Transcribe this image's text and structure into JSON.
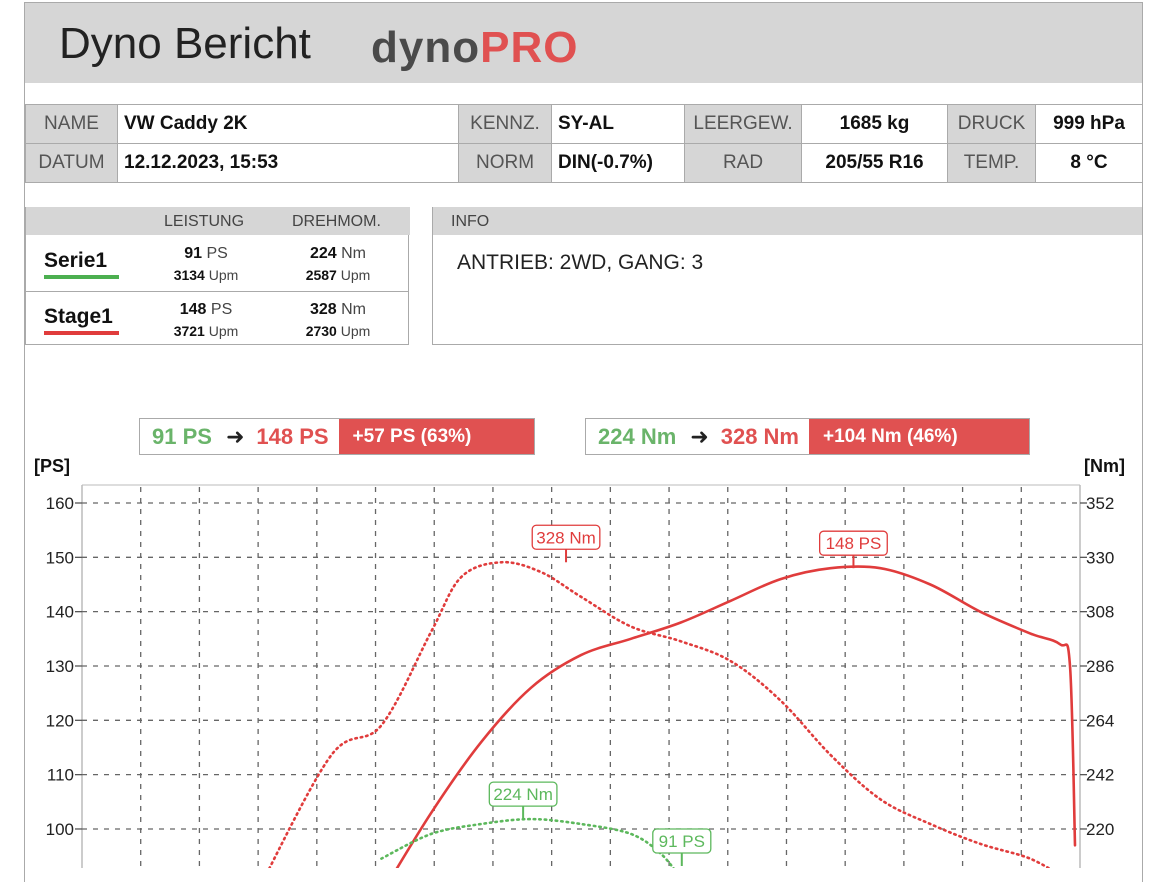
{
  "header": {
    "title": "Dyno Bericht",
    "logo_part1": "dyno",
    "logo_part2": "PRO"
  },
  "meta": {
    "row1": [
      {
        "label": "NAME",
        "value": "VW Caddy 2K"
      },
      {
        "label": "KENNZ.",
        "value": "SY-AL"
      },
      {
        "label": "LEERGEW.",
        "value": "1685 kg"
      },
      {
        "label": "DRUCK",
        "value": "999 hPa"
      }
    ],
    "row2": [
      {
        "label": "DATUM",
        "value": "12.12.2023, 15:53"
      },
      {
        "label": "NORM",
        "value": "DIN(-0.7%)"
      },
      {
        "label": "RAD",
        "value": "205/55 R16"
      },
      {
        "label": "TEMP.",
        "value": "8 °C"
      }
    ]
  },
  "runs": {
    "col_power": "LEISTUNG",
    "col_torque": "DREHMOM.",
    "items": [
      {
        "name": "Serie1",
        "color": "#4caf50",
        "power": "91",
        "power_unit": "PS",
        "power_rpm": "3134",
        "torque": "224",
        "torque_unit": "Nm",
        "torque_rpm": "2587",
        "rpm_unit": "Upm"
      },
      {
        "name": "Stage1",
        "color": "#e03c3c",
        "power": "148",
        "power_unit": "PS",
        "power_rpm": "3721",
        "torque": "328",
        "torque_unit": "Nm",
        "torque_rpm": "2730",
        "rpm_unit": "Upm"
      }
    ]
  },
  "info": {
    "label": "INFO",
    "text": "ANTRIEB: 2WD,  GANG: 3"
  },
  "comparison": {
    "power": {
      "from": "91 PS",
      "to": "148 PS",
      "delta": "+57 PS  (63%)"
    },
    "torque": {
      "from": "224 Nm",
      "to": "328 Nm",
      "delta": "+104 Nm  (46%)"
    }
  },
  "colors": {
    "serie": "#5cb85c",
    "stage": "#e03c3c",
    "header_bg": "#d6d6d6"
  },
  "chart_data": {
    "type": "line",
    "ylabel_left": "[PS]",
    "ylabel_right": "[Nm]",
    "y_left_ticks": [
      160,
      150,
      140,
      130,
      120,
      110,
      100
    ],
    "y_right_ticks": [
      352,
      330,
      308,
      286,
      264,
      242,
      220
    ],
    "ylim_left": [
      90,
      160
    ],
    "ylim_right": [
      198,
      352
    ],
    "grid": true,
    "x_ticks_count": 17,
    "annotations": [
      {
        "text": "328 Nm",
        "series": "Stage1 torque"
      },
      {
        "text": "148 PS",
        "series": "Stage1 power"
      },
      {
        "text": "224 Nm",
        "series": "Serie1 torque"
      },
      {
        "text": "91 PS",
        "series": "Serie1 power"
      }
    ],
    "series": [
      {
        "name": "Stage1",
        "quantity": "power",
        "axis": "left",
        "style": "solid",
        "x": [
          0.3,
          0.35,
          0.4,
          0.45,
          0.5,
          0.55,
          0.6,
          0.65,
          0.7,
          0.75,
          0.8,
          0.85,
          0.9,
          0.95,
          0.98,
          0.99,
          0.995
        ],
        "y": [
          88,
          103,
          116,
          126,
          132,
          135,
          138,
          142,
          146,
          148,
          148,
          145,
          140,
          136,
          134,
          130,
          97
        ]
      },
      {
        "name": "Stage1",
        "quantity": "torque",
        "axis": "right",
        "style": "dotted",
        "x": [
          0.18,
          0.25,
          0.3,
          0.35,
          0.38,
          0.42,
          0.46,
          0.5,
          0.55,
          0.6,
          0.65,
          0.7,
          0.75,
          0.8,
          0.85,
          0.9,
          0.95,
          0.985
        ],
        "y": [
          198,
          250,
          262,
          300,
          322,
          328,
          324,
          314,
          302,
          296,
          288,
          272,
          250,
          232,
          222,
          214,
          208,
          200
        ]
      },
      {
        "name": "Serie1",
        "quantity": "torque",
        "axis": "right",
        "style": "dotted",
        "x": [
          0.3,
          0.35,
          0.4,
          0.45,
          0.5,
          0.55,
          0.58,
          0.6
        ],
        "y": [
          208,
          218,
          222,
          224,
          222,
          218,
          210,
          200
        ]
      },
      {
        "name": "Serie1",
        "quantity": "power",
        "axis": "left",
        "style": "dotted",
        "x": [
          0.58,
          0.6,
          0.62
        ],
        "y": [
          90,
          89,
          88
        ]
      }
    ]
  }
}
